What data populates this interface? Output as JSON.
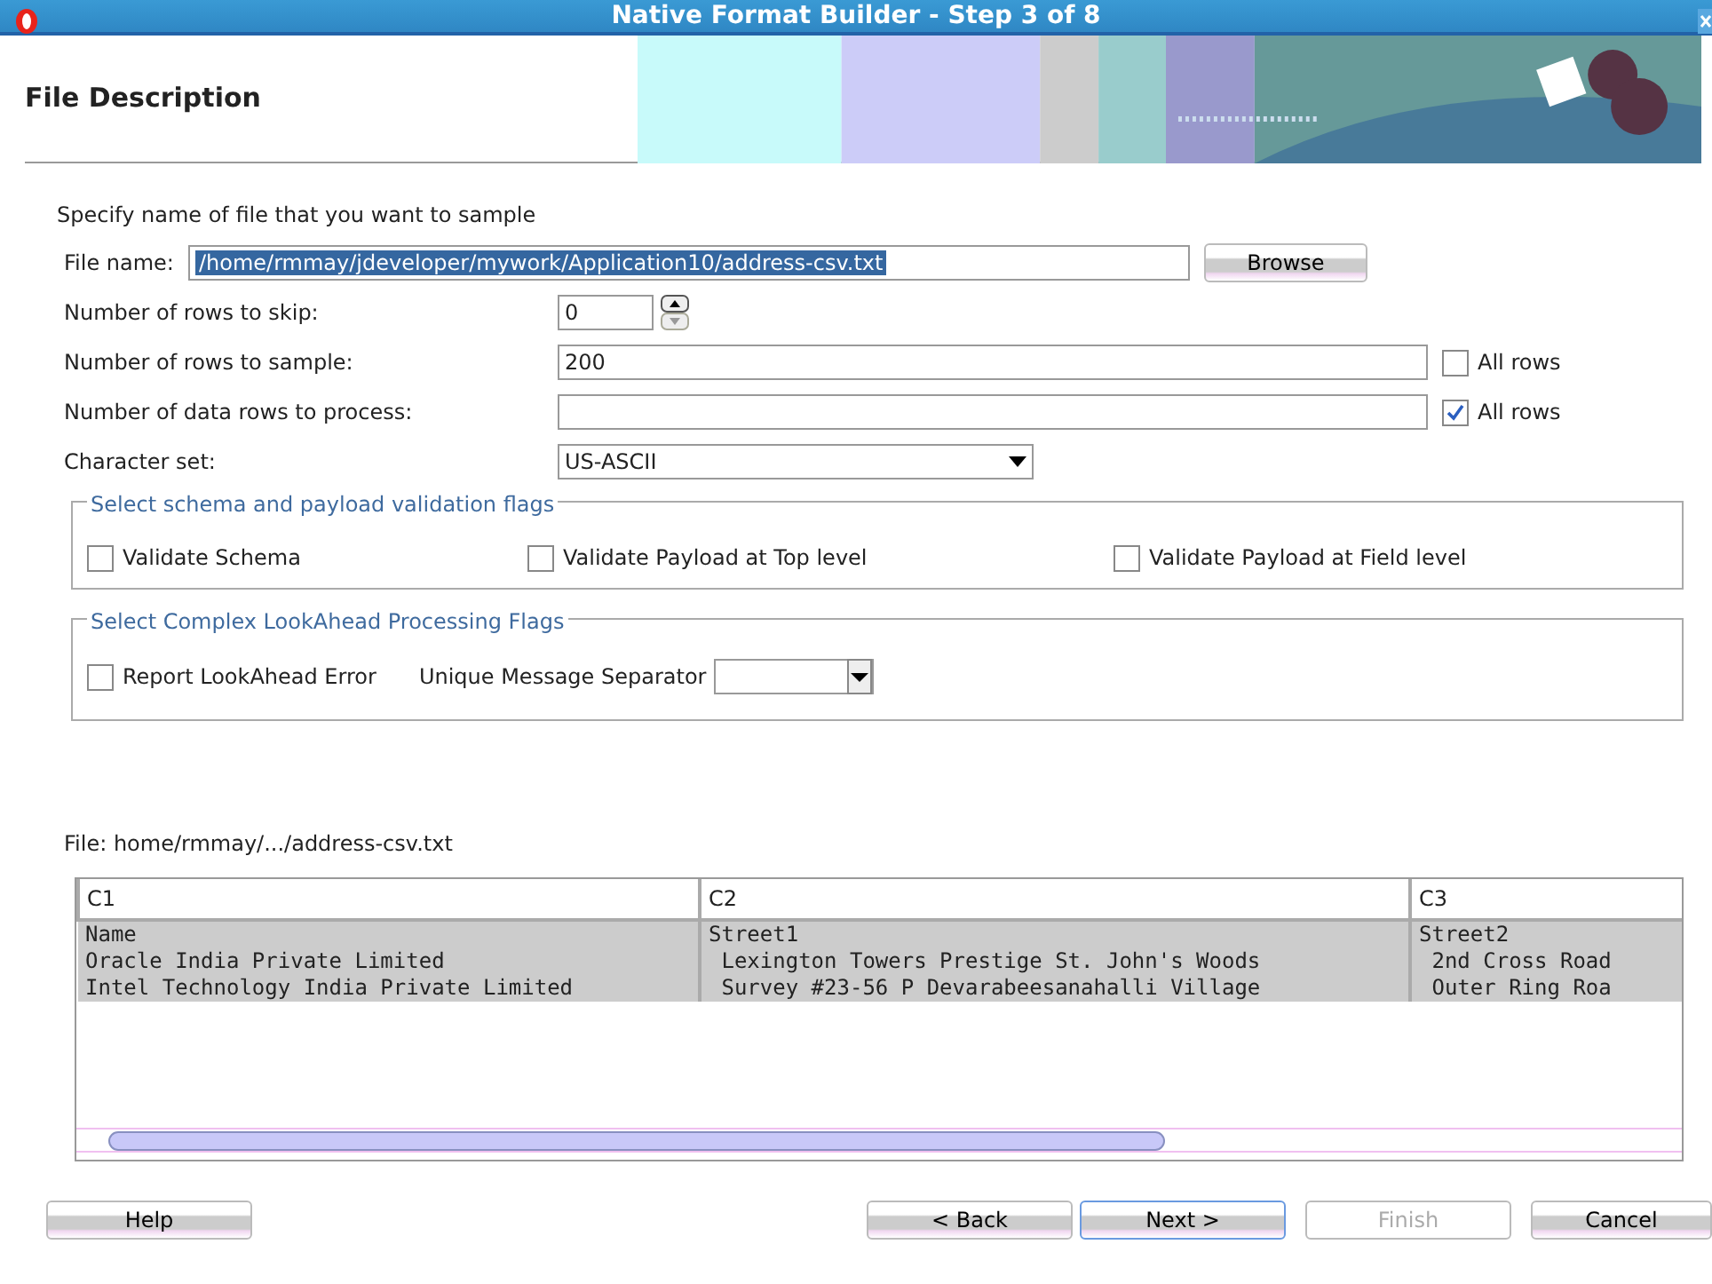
{
  "window": {
    "title": "Native Format Builder - Step 3 of 8"
  },
  "header": {
    "title": "File Description"
  },
  "instruction": "Specify name of file that you want to sample",
  "file_name": {
    "label": "File name:",
    "value": "/home/rmmay/jdeveloper/mywork/Application10/address-csv.txt",
    "selected": true,
    "browse": "Browse"
  },
  "fields": [
    {
      "kind": "spinner",
      "label": "Number of rows to skip:",
      "value": "0"
    },
    {
      "kind": "text",
      "label": "Number of rows to sample:",
      "value": "200",
      "all_rows": {
        "label": "All rows",
        "checked": false
      }
    },
    {
      "kind": "text",
      "label": "Number of data rows to process:",
      "all_rows": {
        "label": "All rows",
        "checked": true
      }
    },
    {
      "kind": "select",
      "label": "Character set:",
      "value": "US-ASCII"
    }
  ],
  "validation_flags": {
    "legend": "Select schema and payload validation flags",
    "options": [
      {
        "label": "Validate Schema",
        "checked": false
      },
      {
        "label": "Validate Payload at Top level",
        "checked": false
      },
      {
        "label": "Validate Payload at Field level",
        "checked": false
      }
    ]
  },
  "lookahead_flags": {
    "legend": "Select Complex LookAhead Processing Flags",
    "report": {
      "label": "Report LookAhead Error",
      "checked": false
    },
    "separator_label": "Unique Message Separator"
  },
  "preview": {
    "file_label": "File: home/rmmay/.../address-csv.txt",
    "columns": [
      "C1",
      "C2",
      "C3"
    ],
    "rows": [
      [
        "Name",
        "Street1",
        "Street2"
      ],
      [
        "Oracle India Private Limited",
        " Lexington Towers Prestige St. John's Woods",
        " 2nd Cross Road"
      ],
      [
        "Intel Technology India Private Limited",
        " Survey #23-56 P Devarabeesanahalli Village",
        " Outer Ring Roa"
      ]
    ]
  },
  "buttons": [
    {
      "label": "Help",
      "disabled": false,
      "focused": false
    },
    {
      "label": "< Back",
      "disabled": false,
      "focused": false
    },
    {
      "label": "Next >",
      "disabled": false,
      "focused": true
    },
    {
      "label": "Finish",
      "disabled": true,
      "focused": false
    },
    {
      "label": "Cancel",
      "disabled": false,
      "focused": false
    }
  ]
}
